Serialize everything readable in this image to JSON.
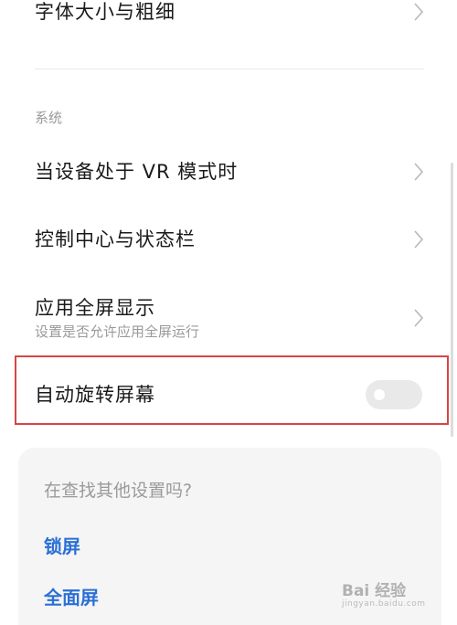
{
  "settings": {
    "rows": [
      {
        "title": "字体大小与粗细"
      },
      {
        "title": "当设备处于 VR 模式时"
      },
      {
        "title": "控制中心与状态栏"
      },
      {
        "title": "应用全屏显示",
        "subtitle": "设置是否允许应用全屏运行"
      },
      {
        "title": "自动旋转屏幕",
        "toggle_on": false
      }
    ],
    "section_label": "系统"
  },
  "suggestions": {
    "title": "在查找其他设置吗?",
    "links": [
      "锁屏",
      "全面屏"
    ]
  },
  "watermark": {
    "brand": "Bai 经验",
    "url": "jingyan.baidu.com"
  },
  "colors": {
    "highlight_border": "#d84545",
    "link": "#2a6fd6",
    "toggle_off": "#e9e9e9"
  }
}
